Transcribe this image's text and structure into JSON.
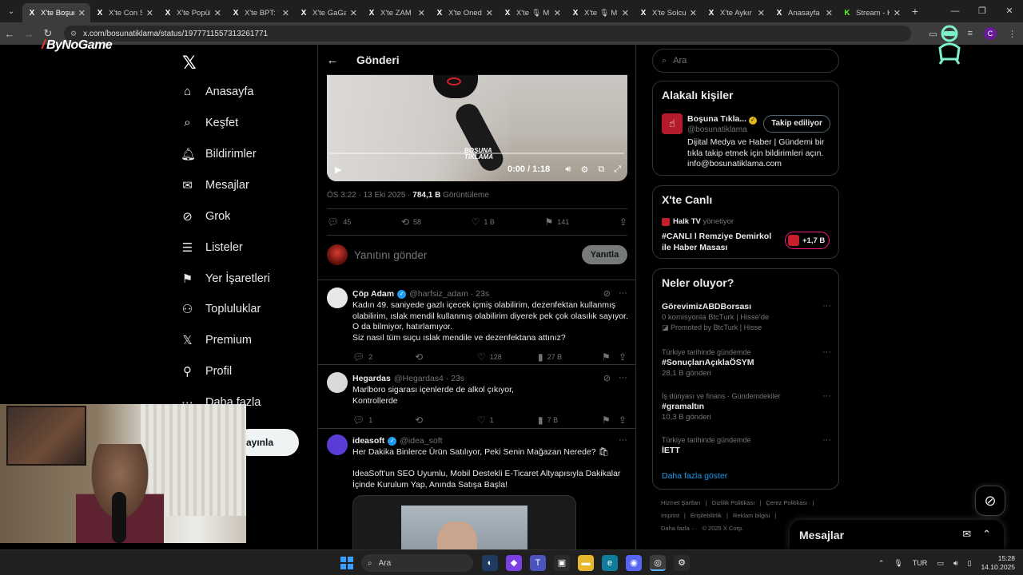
{
  "browser": {
    "tabs": [
      {
        "favicon": "X",
        "title": "X'te Boşuna",
        "active": true
      },
      {
        "favicon": "X",
        "title": "X'te Con S",
        "active": false
      },
      {
        "favicon": "X",
        "title": "X'te Popül",
        "active": false
      },
      {
        "favicon": "X",
        "title": "X'te BPT: \"",
        "active": false
      },
      {
        "favicon": "X",
        "title": "X'te GaGa",
        "active": false
      },
      {
        "favicon": "X",
        "title": "X'te ZAM",
        "active": false
      },
      {
        "favicon": "X",
        "title": "X'te Oned",
        "active": false
      },
      {
        "favicon": "X",
        "title": "X'te 🎙 M",
        "active": false
      },
      {
        "favicon": "X",
        "title": "X'te 🎙 M",
        "active": false
      },
      {
        "favicon": "X",
        "title": "X'te Solcu",
        "active": false
      },
      {
        "favicon": "X",
        "title": "X'te Aykır",
        "active": false
      },
      {
        "favicon": "X",
        "title": "Anasayfa",
        "active": false
      },
      {
        "favicon": "K",
        "title": "Stream - K",
        "active": false
      }
    ],
    "url": "x.com/bosunatiklama/status/1977711557313261771",
    "profile_initial": "C"
  },
  "overlay": {
    "brand": "ByNoGame"
  },
  "nav": {
    "items": [
      {
        "icon": "home-icon",
        "glyph": "⌂",
        "label": "Anasayfa"
      },
      {
        "icon": "search-icon",
        "glyph": "⌕",
        "label": "Keşfet"
      },
      {
        "icon": "bell-icon",
        "glyph": "🔔︎",
        "label": "Bildirimler"
      },
      {
        "icon": "mail-icon",
        "glyph": "✉",
        "label": "Mesajlar"
      },
      {
        "icon": "grok-icon",
        "glyph": "⊘",
        "label": "Grok"
      },
      {
        "icon": "list-icon",
        "glyph": "☰",
        "label": "Listeler"
      },
      {
        "icon": "bookmark-icon",
        "glyph": "⚑",
        "label": "Yer İşaretleri"
      },
      {
        "icon": "communities-icon",
        "glyph": "⚇",
        "label": "Topluluklar"
      },
      {
        "icon": "x-premium-icon",
        "glyph": "𝕏",
        "label": "Premium"
      },
      {
        "icon": "profile-icon",
        "glyph": "⚲",
        "label": "Profil"
      },
      {
        "icon": "more-icon",
        "glyph": "⋯",
        "label": "Daha fazla"
      }
    ],
    "post_button": "ayınla"
  },
  "main": {
    "title": "Gönderi",
    "video": {
      "time": "0:00 / 1:18",
      "watermark": "BOŞUNA TIKLAMA"
    },
    "post_time": "ÖS 3:22 · 13 Eki 2025 · ",
    "post_views": "784,1 B",
    "post_views_label": "Görüntüleme",
    "stats": {
      "replies": "45",
      "reposts": "58",
      "likes": "1 B",
      "bookmarks": "141"
    },
    "reply_placeholder": "Yanıtını gönder",
    "reply_button": "Yanıtla",
    "tweets": [
      {
        "name": "Çöp Adam",
        "verified": true,
        "handle": "@harfsiz_adam · 23s",
        "body": [
          "Kadın 49. saniyede gazlı içecek içmiş olabilirim, dezenfektan kullanmış",
          "olabilirim, ıslak mendil kullanmış olabilirim diyerek pek çok olasılık sayıyor.",
          "O da bilmiyor, hatırlamıyor.",
          "Siz nasıl tüm suçu ıslak mendile ve dezenfektana attınız?"
        ],
        "replies": "2",
        "reposts": "",
        "likes": "128",
        "views": "27 B"
      },
      {
        "name": "Hegardas",
        "verified": false,
        "handle": "@Hegardas4 · 23s",
        "body": [
          "Marlboro sigarası içenlerde de alkol çıkıyor,",
          "Kontrollerde"
        ],
        "replies": "1",
        "reposts": "",
        "likes": "1",
        "views": "7 B"
      },
      {
        "name": "ideasoft",
        "verified": true,
        "handle": "@idea_soft",
        "body": [
          "Her Dakika Binlerce Ürün Satılıyor, Peki Senin Mağazan Nerede? 🛍",
          "",
          "IdeaSoft'un SEO Uyumlu, Mobil Destekli E-Ticaret Altyapısıyla Dakikalar",
          "İçinde Kurulum Yap, Anında Satışa Başla!"
        ]
      }
    ]
  },
  "sidebar": {
    "search_placeholder": "Ara",
    "people": {
      "title": "Alakalı kişiler",
      "name": "Boşuna Tıkla...",
      "handle": "@bosunatiklama",
      "follow_button": "Takip ediliyor",
      "bio": "Dijital Medya ve Haber | Gündemi bir tıkla takip etmek için bildirimleri açın. info@bosunatiklama.com"
    },
    "live": {
      "title": "X'te Canlı",
      "host": "Halk TV",
      "host_role": "yönetiyor",
      "stream_title": "#CANLI l Remziye Demirkol ile Haber Masası",
      "listeners": "+1,7 B"
    },
    "trends": {
      "title": "Neler oluyor?",
      "items": [
        {
          "meta": "",
          "name": "GörevimizABDBorsası",
          "sub": "0 komisyonla BtcTurk | Hisse'de",
          "sub2": "Promoted by BtcTurk | Hisse"
        },
        {
          "meta": "Türkiye tarihinde gündemde",
          "name": "#SonuçlarıAçıklaÖSYM",
          "sub": "28,1 B gönderi",
          "sub2": ""
        },
        {
          "meta": "İş dünyası ve finans · Gündemdekiler",
          "name": "#gramaltın",
          "sub": "10,3 B gönderi",
          "sub2": ""
        },
        {
          "meta": "Türkiye tarihinde gündemde",
          "name": "İETT",
          "sub": "",
          "sub2": ""
        }
      ],
      "show_more": "Daha fazla göster"
    },
    "footer": [
      "Hizmet Şartları",
      "|",
      "Gizlilik Politikası",
      "|",
      "Çerez Politikası",
      "|",
      "Imprint",
      "|",
      "Erişilebilirlik",
      "|",
      "Reklam bilgisi",
      "|",
      "Daha fazla ···",
      "© 2025 X Corp."
    ]
  },
  "messages_drawer": {
    "title": "Mesajlar"
  },
  "taskbar": {
    "search": "Ara",
    "lang": "TUR",
    "time": "15:28",
    "date": "14.10.2025"
  },
  "colors": {
    "accent": "#1d9bf0",
    "background": "#000000",
    "border": "#2f3336",
    "muted": "#71767b",
    "live_pink": "#f91880"
  }
}
